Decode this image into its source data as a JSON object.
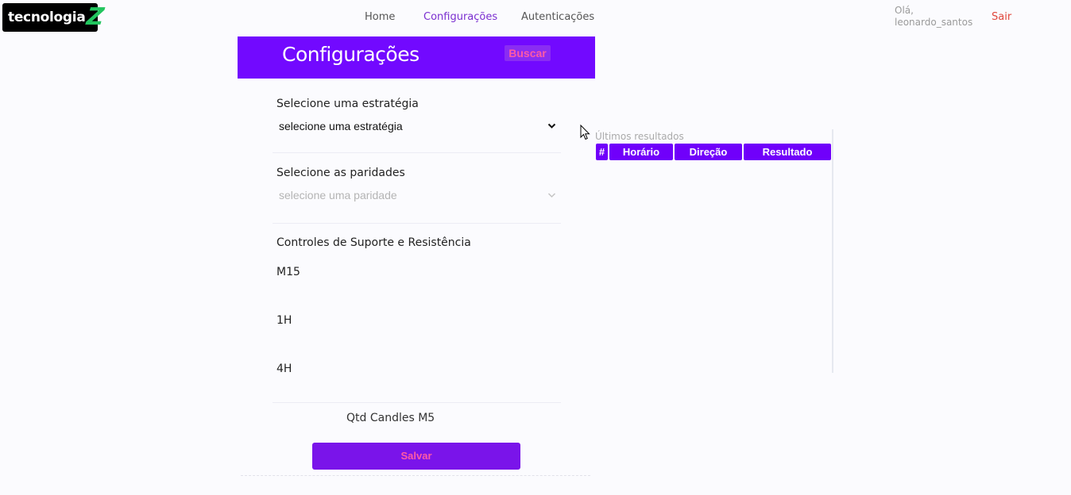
{
  "logo": {
    "text": "tecnologia",
    "mark": "Z"
  },
  "nav": {
    "home": "Home",
    "config": "Configurações",
    "auth": "Autenticações"
  },
  "user": {
    "greeting": "Olá, leonardo_santos",
    "logout": "Sair"
  },
  "header": {
    "title": "Configurações",
    "search_label": "Buscar"
  },
  "form": {
    "strategy_label": "Selecione uma estratégia",
    "strategy_value": "selecione uma estratégia",
    "pairs_label": "Selecione as paridades",
    "pairs_placeholder": "selecione uma paridade",
    "sr_label": "Controles de Suporte e Resistência",
    "timeframes": [
      "M15",
      "1H",
      "4H"
    ],
    "candles_label": "Qtd Candles M5",
    "save_label": "Salvar"
  },
  "results": {
    "caption": "Últimos resultados",
    "columns": [
      "#",
      "Horário",
      "Direção",
      "Resultado"
    ],
    "rows": []
  },
  "colors": {
    "accent": "#7209ff",
    "button_text": "#ff5aa6",
    "active_nav": "#7b2fd0",
    "logout": "#e0483d",
    "logo_green": "#22c55e"
  }
}
